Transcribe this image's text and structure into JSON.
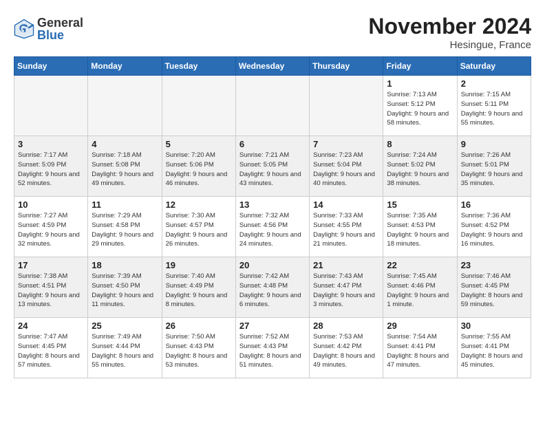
{
  "logo": {
    "general": "General",
    "blue": "Blue"
  },
  "title": "November 2024",
  "location": "Hesingue, France",
  "days_of_week": [
    "Sunday",
    "Monday",
    "Tuesday",
    "Wednesday",
    "Thursday",
    "Friday",
    "Saturday"
  ],
  "weeks": [
    [
      {
        "day": "",
        "info": ""
      },
      {
        "day": "",
        "info": ""
      },
      {
        "day": "",
        "info": ""
      },
      {
        "day": "",
        "info": ""
      },
      {
        "day": "",
        "info": ""
      },
      {
        "day": "1",
        "info": "Sunrise: 7:13 AM\nSunset: 5:12 PM\nDaylight: 9 hours and 58 minutes."
      },
      {
        "day": "2",
        "info": "Sunrise: 7:15 AM\nSunset: 5:11 PM\nDaylight: 9 hours and 55 minutes."
      }
    ],
    [
      {
        "day": "3",
        "info": "Sunrise: 7:17 AM\nSunset: 5:09 PM\nDaylight: 9 hours and 52 minutes."
      },
      {
        "day": "4",
        "info": "Sunrise: 7:18 AM\nSunset: 5:08 PM\nDaylight: 9 hours and 49 minutes."
      },
      {
        "day": "5",
        "info": "Sunrise: 7:20 AM\nSunset: 5:06 PM\nDaylight: 9 hours and 46 minutes."
      },
      {
        "day": "6",
        "info": "Sunrise: 7:21 AM\nSunset: 5:05 PM\nDaylight: 9 hours and 43 minutes."
      },
      {
        "day": "7",
        "info": "Sunrise: 7:23 AM\nSunset: 5:04 PM\nDaylight: 9 hours and 40 minutes."
      },
      {
        "day": "8",
        "info": "Sunrise: 7:24 AM\nSunset: 5:02 PM\nDaylight: 9 hours and 38 minutes."
      },
      {
        "day": "9",
        "info": "Sunrise: 7:26 AM\nSunset: 5:01 PM\nDaylight: 9 hours and 35 minutes."
      }
    ],
    [
      {
        "day": "10",
        "info": "Sunrise: 7:27 AM\nSunset: 4:59 PM\nDaylight: 9 hours and 32 minutes."
      },
      {
        "day": "11",
        "info": "Sunrise: 7:29 AM\nSunset: 4:58 PM\nDaylight: 9 hours and 29 minutes."
      },
      {
        "day": "12",
        "info": "Sunrise: 7:30 AM\nSunset: 4:57 PM\nDaylight: 9 hours and 26 minutes."
      },
      {
        "day": "13",
        "info": "Sunrise: 7:32 AM\nSunset: 4:56 PM\nDaylight: 9 hours and 24 minutes."
      },
      {
        "day": "14",
        "info": "Sunrise: 7:33 AM\nSunset: 4:55 PM\nDaylight: 9 hours and 21 minutes."
      },
      {
        "day": "15",
        "info": "Sunrise: 7:35 AM\nSunset: 4:53 PM\nDaylight: 9 hours and 18 minutes."
      },
      {
        "day": "16",
        "info": "Sunrise: 7:36 AM\nSunset: 4:52 PM\nDaylight: 9 hours and 16 minutes."
      }
    ],
    [
      {
        "day": "17",
        "info": "Sunrise: 7:38 AM\nSunset: 4:51 PM\nDaylight: 9 hours and 13 minutes."
      },
      {
        "day": "18",
        "info": "Sunrise: 7:39 AM\nSunset: 4:50 PM\nDaylight: 9 hours and 11 minutes."
      },
      {
        "day": "19",
        "info": "Sunrise: 7:40 AM\nSunset: 4:49 PM\nDaylight: 9 hours and 8 minutes."
      },
      {
        "day": "20",
        "info": "Sunrise: 7:42 AM\nSunset: 4:48 PM\nDaylight: 9 hours and 6 minutes."
      },
      {
        "day": "21",
        "info": "Sunrise: 7:43 AM\nSunset: 4:47 PM\nDaylight: 9 hours and 3 minutes."
      },
      {
        "day": "22",
        "info": "Sunrise: 7:45 AM\nSunset: 4:46 PM\nDaylight: 9 hours and 1 minute."
      },
      {
        "day": "23",
        "info": "Sunrise: 7:46 AM\nSunset: 4:45 PM\nDaylight: 8 hours and 59 minutes."
      }
    ],
    [
      {
        "day": "24",
        "info": "Sunrise: 7:47 AM\nSunset: 4:45 PM\nDaylight: 8 hours and 57 minutes."
      },
      {
        "day": "25",
        "info": "Sunrise: 7:49 AM\nSunset: 4:44 PM\nDaylight: 8 hours and 55 minutes."
      },
      {
        "day": "26",
        "info": "Sunrise: 7:50 AM\nSunset: 4:43 PM\nDaylight: 8 hours and 53 minutes."
      },
      {
        "day": "27",
        "info": "Sunrise: 7:52 AM\nSunset: 4:43 PM\nDaylight: 8 hours and 51 minutes."
      },
      {
        "day": "28",
        "info": "Sunrise: 7:53 AM\nSunset: 4:42 PM\nDaylight: 8 hours and 49 minutes."
      },
      {
        "day": "29",
        "info": "Sunrise: 7:54 AM\nSunset: 4:41 PM\nDaylight: 8 hours and 47 minutes."
      },
      {
        "day": "30",
        "info": "Sunrise: 7:55 AM\nSunset: 4:41 PM\nDaylight: 8 hours and 45 minutes."
      }
    ]
  ]
}
